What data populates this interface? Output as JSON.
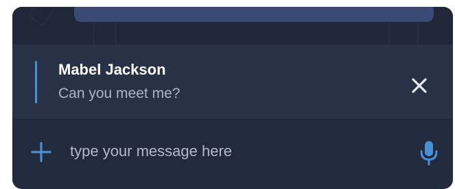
{
  "reply_preview": {
    "sender_name": "Mabel Jackson",
    "message_text": "Can you meet me?"
  },
  "composer": {
    "placeholder": "type your message here",
    "value": ""
  },
  "icons": {
    "close": "close-icon",
    "add": "plus-icon",
    "mic": "microphone-icon"
  },
  "colors": {
    "panel_background": "#222a3d",
    "reply_background": "#283247",
    "accent": "#4a90d9",
    "message_bubble": "#3b4a74"
  }
}
